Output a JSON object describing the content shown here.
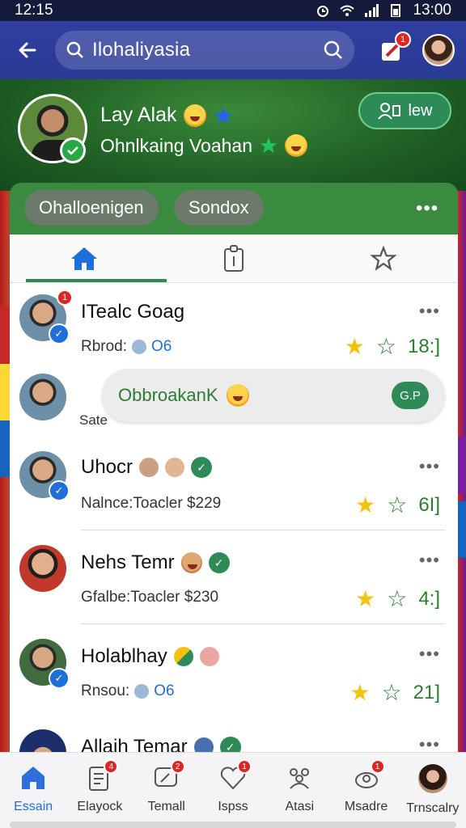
{
  "status_bar": {
    "time_left": "12:15",
    "time_right": "13:00"
  },
  "app_bar": {
    "search_query": "Ilohaliyasia",
    "edit_badge": "1"
  },
  "profile": {
    "name": "Lay Alak",
    "subtitle": "Ohnlkaing Voahan",
    "view_button": "lew"
  },
  "chips": [
    "Ohalloenigen",
    "Sondox"
  ],
  "tabs": [
    {
      "icon": "home-icon",
      "active": true
    },
    {
      "icon": "clipboard-icon",
      "active": false
    },
    {
      "icon": "star-icon",
      "active": false
    }
  ],
  "list": {
    "rows": [
      {
        "title": "ITealc Goag",
        "sub_label": "Rbrod:",
        "sub_value": "O6",
        "stat": "18:]",
        "avatar_badge": "1"
      },
      {
        "title": "Uhocr",
        "sub_label": "Nalnce:Toacler $229",
        "sub_value": "",
        "stat": "6I]"
      },
      {
        "title": "Nehs Temr",
        "sub_label": "Gfalbe:Toacler $230",
        "sub_value": "",
        "stat": "4:]"
      },
      {
        "title": "Holablhay",
        "sub_label": "Rnsou:",
        "sub_value": "O6",
        "stat": "21]"
      },
      {
        "title": "Allaih Temar"
      }
    ],
    "bubble": {
      "text": "ObbroakanK",
      "pill": "G.P",
      "caption": "Sate"
    }
  },
  "bottom_nav": [
    {
      "label": "Essain",
      "icon": "home-icon",
      "active": true,
      "badge": ""
    },
    {
      "label": "Elayock",
      "icon": "calendar-icon",
      "active": false,
      "badge": "4"
    },
    {
      "label": "Temall",
      "icon": "chat-icon",
      "active": false,
      "badge": "2"
    },
    {
      "label": "Ispss",
      "icon": "heart-icon",
      "active": false,
      "badge": "1"
    },
    {
      "label": "Atasi",
      "icon": "group-icon",
      "active": false,
      "badge": ""
    },
    {
      "label": "Msadre",
      "icon": "message-icon",
      "active": false,
      "badge": "1"
    },
    {
      "label": "Trnscalry",
      "icon": "avatar",
      "active": false,
      "badge": ""
    }
  ],
  "colors": {
    "app_bar": "#2f3fa0",
    "accent_green": "#2e8b57",
    "star": "#f4c20d",
    "link_blue": "#1e6fd9"
  }
}
